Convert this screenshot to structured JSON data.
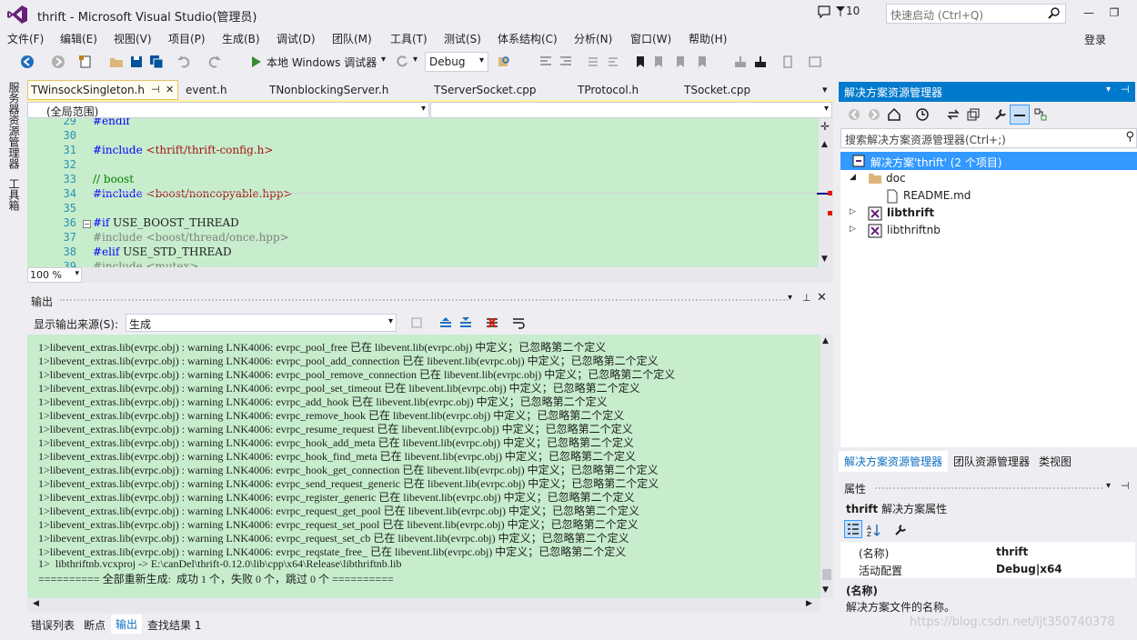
{
  "window": {
    "title": "thrift - Microsoft Visual Studio(管理员)",
    "flag_count": "10",
    "quick_launch_placeholder": "快速启动 (Ctrl+Q)",
    "login": "登录"
  },
  "menu": [
    "文件(F)",
    "编辑(E)",
    "视图(V)",
    "项目(P)",
    "生成(B)",
    "调试(D)",
    "团队(M)",
    "工具(T)",
    "测试(S)",
    "体系结构(C)",
    "分析(N)",
    "窗口(W)",
    "帮助(H)"
  ],
  "toolbar": {
    "run_label": "本地 Windows 调试器",
    "config": "Debug"
  },
  "left_strip": [
    "服务器资源管理器",
    "工具箱"
  ],
  "editor": {
    "tabs": [
      "TWinsockSingleton.h",
      "event.h",
      "TNonblockingServer.h",
      "TServerSocket.cpp",
      "TProtocol.h",
      "TSocket.cpp"
    ],
    "scope": "(全局范围)",
    "zoom": "100 %",
    "lines": [
      {
        "n": "29",
        "parts": [
          {
            "t": "#endif",
            "c": "kw"
          }
        ]
      },
      {
        "n": "30",
        "parts": [
          {
            "t": "",
            "c": ""
          }
        ]
      },
      {
        "n": "31",
        "parts": [
          {
            "t": "#include ",
            "c": "kw"
          },
          {
            "t": "<thrift/thrift-config.h>",
            "c": "str"
          }
        ]
      },
      {
        "n": "32",
        "parts": [
          {
            "t": "",
            "c": ""
          }
        ]
      },
      {
        "n": "33",
        "parts": [
          {
            "t": "// boost",
            "c": "cm"
          }
        ]
      },
      {
        "n": "34",
        "parts": [
          {
            "t": "#include ",
            "c": "kw"
          },
          {
            "t": "<boost/noncopyable.hpp>",
            "c": "str"
          }
        ]
      },
      {
        "n": "35",
        "parts": [
          {
            "t": "",
            "c": ""
          }
        ]
      },
      {
        "n": "36",
        "parts": [
          {
            "t": "#if ",
            "c": "kw"
          },
          {
            "t": "USE_BOOST_THREAD",
            "c": ""
          }
        ]
      },
      {
        "n": "37",
        "parts": [
          {
            "t": "#include <boost/thread/once.hpp>",
            "c": "gr"
          }
        ]
      },
      {
        "n": "38",
        "parts": [
          {
            "t": "#elif ",
            "c": "kw"
          },
          {
            "t": "USE_STD_THREAD",
            "c": ""
          }
        ]
      },
      {
        "n": "39",
        "parts": [
          {
            "t": "#include <mutex>",
            "c": "gr"
          }
        ]
      }
    ]
  },
  "output": {
    "title": "输出",
    "source_label": "显示输出来源(S):",
    "source_value": "生成",
    "lines": [
      "1>libevent_extras.lib(evrpc.obj) : warning LNK4006: evrpc_pool_free 已在 libevent.lib(evrpc.obj) 中定义；已忽略第二个定义",
      "1>libevent_extras.lib(evrpc.obj) : warning LNK4006: evrpc_pool_add_connection 已在 libevent.lib(evrpc.obj) 中定义；已忽略第二个定义",
      "1>libevent_extras.lib(evrpc.obj) : warning LNK4006: evrpc_pool_remove_connection 已在 libevent.lib(evrpc.obj) 中定义；已忽略第二个定义",
      "1>libevent_extras.lib(evrpc.obj) : warning LNK4006: evrpc_pool_set_timeout 已在 libevent.lib(evrpc.obj) 中定义；已忽略第二个定义",
      "1>libevent_extras.lib(evrpc.obj) : warning LNK4006: evrpc_add_hook 已在 libevent.lib(evrpc.obj) 中定义；已忽略第二个定义",
      "1>libevent_extras.lib(evrpc.obj) : warning LNK4006: evrpc_remove_hook 已在 libevent.lib(evrpc.obj) 中定义；已忽略第二个定义",
      "1>libevent_extras.lib(evrpc.obj) : warning LNK4006: evrpc_resume_request 已在 libevent.lib(evrpc.obj) 中定义；已忽略第二个定义",
      "1>libevent_extras.lib(evrpc.obj) : warning LNK4006: evrpc_hook_add_meta 已在 libevent.lib(evrpc.obj) 中定义；已忽略第二个定义",
      "1>libevent_extras.lib(evrpc.obj) : warning LNK4006: evrpc_hook_find_meta 已在 libevent.lib(evrpc.obj) 中定义；已忽略第二个定义",
      "1>libevent_extras.lib(evrpc.obj) : warning LNK4006: evrpc_hook_get_connection 已在 libevent.lib(evrpc.obj) 中定义；已忽略第二个定义",
      "1>libevent_extras.lib(evrpc.obj) : warning LNK4006: evrpc_send_request_generic 已在 libevent.lib(evrpc.obj) 中定义；已忽略第二个定义",
      "1>libevent_extras.lib(evrpc.obj) : warning LNK4006: evrpc_register_generic 已在 libevent.lib(evrpc.obj) 中定义；已忽略第二个定义",
      "1>libevent_extras.lib(evrpc.obj) : warning LNK4006: evrpc_request_get_pool 已在 libevent.lib(evrpc.obj) 中定义；已忽略第二个定义",
      "1>libevent_extras.lib(evrpc.obj) : warning LNK4006: evrpc_request_set_pool 已在 libevent.lib(evrpc.obj) 中定义；已忽略第二个定义",
      "1>libevent_extras.lib(evrpc.obj) : warning LNK4006: evrpc_request_set_cb 已在 libevent.lib(evrpc.obj) 中定义；已忽略第二个定义",
      "1>libevent_extras.lib(evrpc.obj) : warning LNK4006: evrpc_reqstate_free_ 已在 libevent.lib(evrpc.obj) 中定义；已忽略第二个定义",
      "1>  libthriftnb.vcxproj -> E:\\canDel\\thrift-0.12.0\\lib\\cpp\\x64\\Release\\libthriftnb.lib",
      "========== 全部重新生成:  成功 1 个，失败 0 个，跳过 0 个 =========="
    ]
  },
  "bottom_tabs": [
    "错误列表",
    "断点",
    "输出",
    "查找结果 1"
  ],
  "solution_explorer": {
    "title": "解决方案资源管理器",
    "search_placeholder": "搜索解决方案资源管理器(Ctrl+;)",
    "solution": "解决方案'thrift' (2 个项目)",
    "folder": "doc",
    "file": "README.md",
    "project1": "libthrift",
    "project2": "libthriftnb",
    "tabs": [
      "解决方案资源管理器",
      "团队资源管理器",
      "类视图"
    ]
  },
  "properties": {
    "title": "属性",
    "object": "thrift",
    "object_desc": "解决方案属性",
    "rows": [
      {
        "k": "(名称)",
        "v": "thrift"
      },
      {
        "k": "活动配置",
        "v": "Debug|x64"
      }
    ],
    "desc_title": "(名称)",
    "desc_text": "解决方案文件的名称。"
  },
  "watermark": "https://blog.csdn.net/ljt350740378",
  "colors": {
    "accent": "#007acc",
    "editor_bg": "#c7edcc",
    "vs_purple": "#68217a"
  }
}
